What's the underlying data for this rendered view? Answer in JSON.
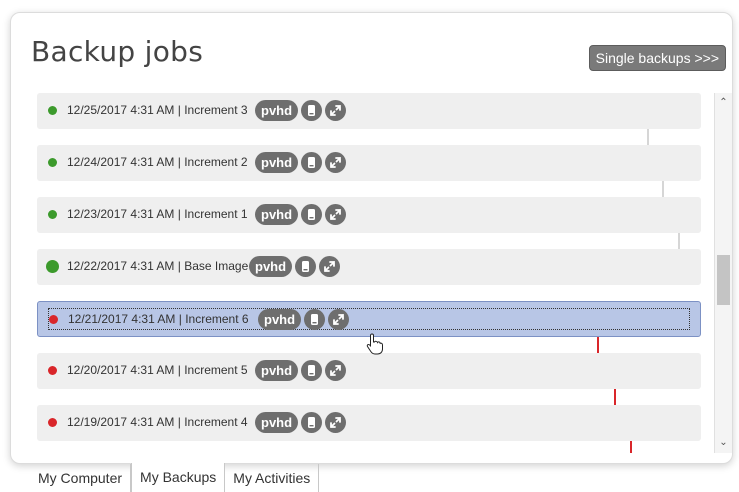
{
  "header": {
    "title": "Backup jobs",
    "single_backups_label": "Single backups >>>"
  },
  "backups": [
    {
      "text": "12/25/2017 4:31 AM | Increment 3",
      "status": "green",
      "badge": "pvhd"
    },
    {
      "text": "12/24/2017 4:31 AM | Increment 2",
      "status": "green",
      "badge": "pvhd"
    },
    {
      "text": "12/23/2017 4:31 AM | Increment 1",
      "status": "green",
      "badge": "pvhd"
    },
    {
      "text": "12/22/2017 4:31 AM | Base Image",
      "status": "green",
      "badge": "pvhd"
    },
    {
      "text": "12/21/2017 4:31 AM | Increment 6",
      "status": "red",
      "badge": "pvhd",
      "selected": true
    },
    {
      "text": "12/20/2017 4:31 AM | Increment 5",
      "status": "red",
      "badge": "pvhd"
    },
    {
      "text": "12/19/2017 4:31 AM | Increment 4",
      "status": "red",
      "badge": "pvhd"
    }
  ],
  "tabs": [
    {
      "label": "My Computer",
      "active": false
    },
    {
      "label": "My Backups",
      "active": true
    },
    {
      "label": "My Activities",
      "active": false
    }
  ],
  "colors": {
    "status_green": "#3c9a2c",
    "status_red": "#d9262a",
    "chain_gray": "#d6d6d6",
    "badge_gray": "#6e6e6e",
    "selection": "#b8c6e6"
  },
  "icons": {
    "drive": "drive-icon",
    "expand": "expand-arrows-icon",
    "scroll_up": "chevron-up-icon",
    "scroll_down": "chevron-down-icon",
    "cursor": "hand-pointer-icon"
  }
}
